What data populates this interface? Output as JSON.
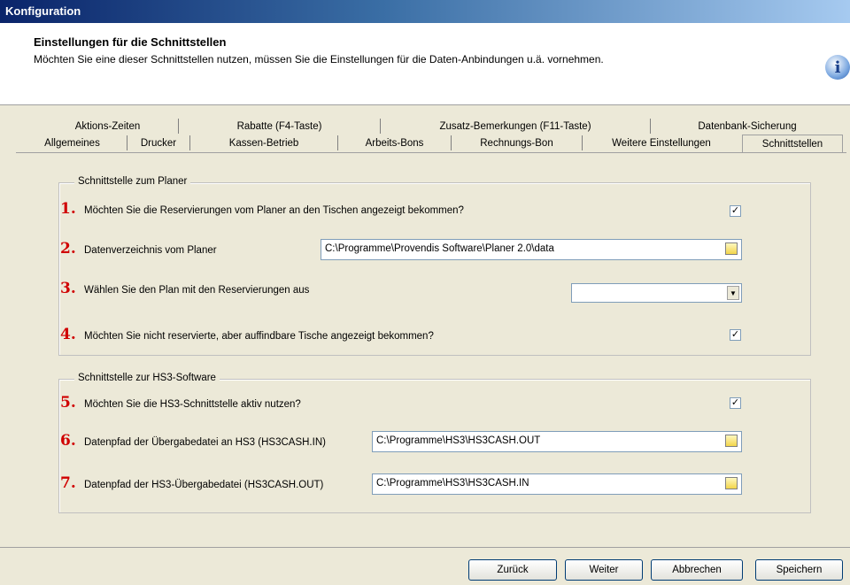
{
  "window": {
    "title": "Konfiguration"
  },
  "header": {
    "title": "Einstellungen für die Schnittstellen",
    "subtitle": "Möchten Sie eine dieser Schnittstellen nutzen, müssen Sie die Einstellungen für die Daten-Anbindungen u.ä. vornehmen.",
    "info_icon": "i"
  },
  "tabs_row1": [
    "Aktions-Zeiten",
    "Rabatte (F4-Taste)",
    "Zusatz-Bemerkungen (F11-Taste)",
    "Datenbank-Sicherung"
  ],
  "tabs_row2": [
    "Allgemeines",
    "Drucker",
    "Kassen-Betrieb",
    "Arbeits-Bons",
    "Rechnungs-Bon",
    "Weitere Einstellungen",
    "Schnittstellen"
  ],
  "planer": {
    "title": "Schnittstelle zum Planer",
    "q1": {
      "num": "1.",
      "label": "Möchten Sie die Reservierungen vom Planer an den Tischen angezeigt bekommen?",
      "check": "✓"
    },
    "q2": {
      "num": "2.",
      "label": "Datenverzeichnis vom Planer",
      "value": "C:\\Programme\\Provendis Software\\Planer 2.0\\data"
    },
    "q3": {
      "num": "3.",
      "label": "Wählen Sie den Plan mit den Reservierungen aus",
      "value": ""
    },
    "q4": {
      "num": "4.",
      "label": "Möchten Sie nicht reservierte, aber auffindbare Tische angezeigt bekommen?",
      "check": "✓"
    }
  },
  "hs3": {
    "title": "Schnittstelle zur HS3-Software",
    "q5": {
      "num": "5.",
      "label": "Möchten Sie die HS3-Schnittstelle aktiv nutzen?",
      "check": "✓"
    },
    "q6": {
      "num": "6.",
      "label": "Datenpfad der Übergabedatei an HS3 (HS3CASH.IN)",
      "value": "C:\\Programme\\HS3\\HS3CASH.OUT"
    },
    "q7": {
      "num": "7.",
      "label": "Datenpfad der HS3-Übergabedatei (HS3CASH.OUT)",
      "value": "C:\\Programme\\HS3\\HS3CASH.IN"
    }
  },
  "buttons": {
    "back": "Zurück",
    "next": "Weiter",
    "cancel": "Abbrechen",
    "save": "Speichern"
  },
  "icons": {
    "info": "info-icon",
    "folder": "folder-icon",
    "combo_arrow": "chevron-down-icon",
    "checkmark": "checkmark-icon"
  }
}
